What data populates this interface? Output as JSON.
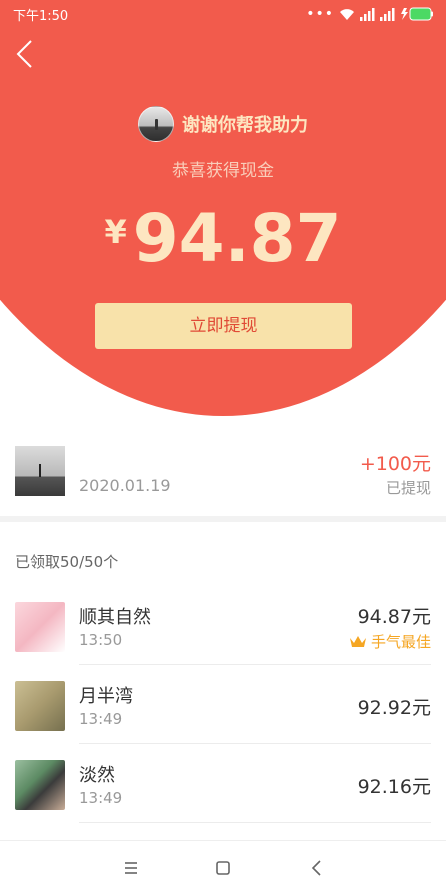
{
  "status_bar": {
    "time": "下午1:50",
    "icons": [
      "more-dots-icon",
      "wifi-icon",
      "signal-hd-icon",
      "signal-icon",
      "battery-charging-icon"
    ]
  },
  "header": {
    "back_icon": "chevron-left-icon",
    "giver_name": "谢谢你帮我助力",
    "subtitle": "恭喜获得现金",
    "currency": "¥",
    "amount": "94.87",
    "withdraw_label": "立即提现",
    "colors": {
      "background": "#f25b4c",
      "amount": "#fde6c1",
      "button": "#f8e2aa",
      "button_text": "#e04a36"
    }
  },
  "record": {
    "date": "2020.01.19",
    "change": "+100元",
    "status": "已提现"
  },
  "received_count": "已领取50/50个",
  "list": [
    {
      "name": "顺其自然",
      "time": "13:50",
      "value": "94.87元",
      "badge": "手气最佳"
    },
    {
      "name": "月半湾",
      "time": "13:49",
      "value": "92.92元"
    },
    {
      "name": "淡然",
      "time": "13:49",
      "value": "92.16元"
    }
  ],
  "nav": [
    "menu-icon",
    "home-square-icon",
    "back-icon"
  ]
}
